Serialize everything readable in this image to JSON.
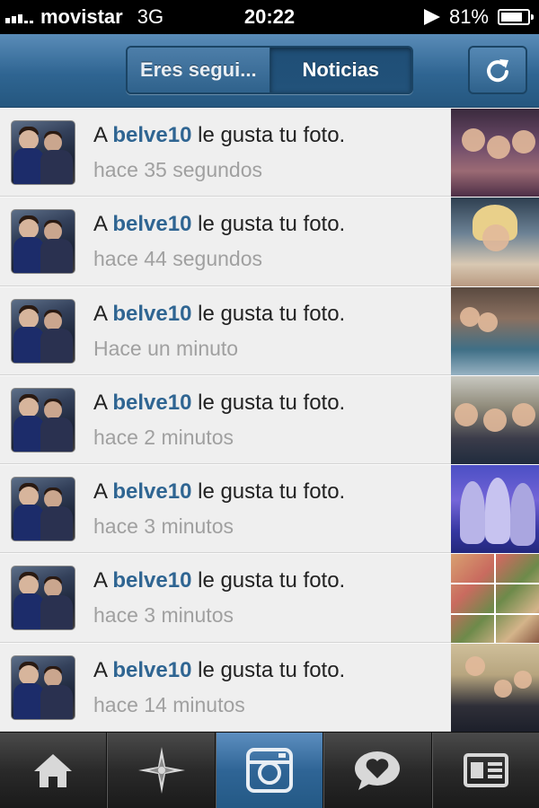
{
  "status_bar": {
    "carrier": "movistar",
    "network": "3G",
    "time": "20:22",
    "battery_percent_label": "81%",
    "battery_level": 0.81
  },
  "header": {
    "tabs": [
      {
        "label": "Eres segui...",
        "selected": false
      },
      {
        "label": "Noticias",
        "selected": true
      }
    ],
    "refresh_icon": "refresh-icon"
  },
  "notifications": [
    {
      "prefix": "A",
      "user": "belve10",
      "action": "le gusta tu foto.",
      "time": "hace 35 segundos"
    },
    {
      "prefix": "A",
      "user": "belve10",
      "action": "le gusta tu foto.",
      "time": "hace 44 segundos"
    },
    {
      "prefix": "A",
      "user": "belve10",
      "action": "le gusta tu foto.",
      "time": "Hace un minuto"
    },
    {
      "prefix": "A",
      "user": "belve10",
      "action": "le gusta tu foto.",
      "time": "hace 2 minutos"
    },
    {
      "prefix": "A",
      "user": "belve10",
      "action": "le gusta tu foto.",
      "time": "hace 3 minutos"
    },
    {
      "prefix": "A",
      "user": "belve10",
      "action": "le gusta tu foto.",
      "time": "hace 3 minutos"
    },
    {
      "prefix": "A",
      "user": "belve10",
      "action": "le gusta tu foto.",
      "time": "hace 14 minutos"
    }
  ],
  "tab_bar": {
    "items": [
      {
        "icon": "home-icon",
        "active": false
      },
      {
        "icon": "explore-star-icon",
        "active": false
      },
      {
        "icon": "camera-icon",
        "active": true
      },
      {
        "icon": "activity-heart-bubble-icon",
        "active": false
      },
      {
        "icon": "profile-card-icon",
        "active": false
      }
    ]
  },
  "colors": {
    "accent_blue": "#2f6592",
    "username_blue": "#2f6592",
    "timestamp_gray": "#a0a0a0",
    "list_background": "#efefef"
  }
}
